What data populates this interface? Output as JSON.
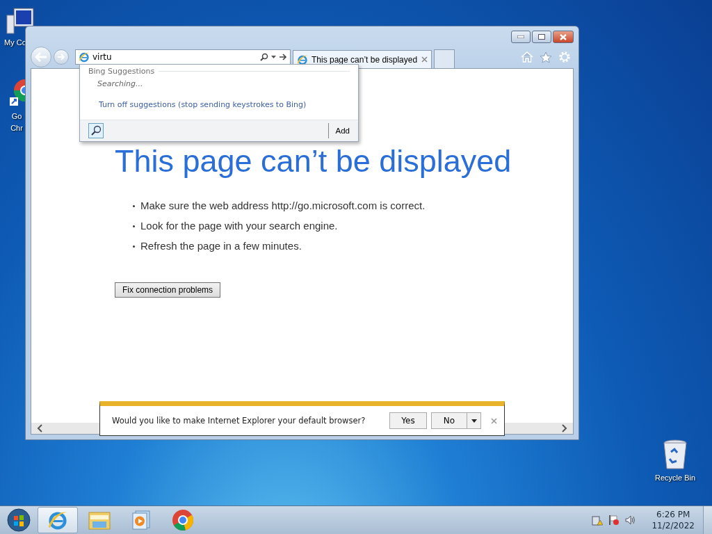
{
  "desktop_icons": [
    {
      "kind": "computer",
      "lines": [
        "My Co"
      ]
    },
    {
      "kind": "chrome-shortcut",
      "lines": [
        "Go",
        "Chr"
      ]
    },
    {
      "kind": "recycle-bin",
      "lines": [
        "Recycle Bin"
      ]
    }
  ],
  "browser": {
    "address": {
      "value": "virtu"
    },
    "tabs": [
      {
        "title": "This page can’t be displayed",
        "selected": true
      }
    ],
    "suggestions": {
      "heading": "Bing Suggestions",
      "status": "Searching...",
      "link": "Turn off suggestions (stop sending keystrokes to Bing)",
      "add": "Add"
    },
    "page": {
      "heading": "This page can’t be displayed",
      "bullets": [
        "Make sure the web address http://go.microsoft.com is correct.",
        "Look for the page with your search engine.",
        "Refresh the page in a few minutes."
      ],
      "button": "Fix connection problems"
    },
    "notification": {
      "message": "Would you like to make Internet Explorer your default browser?",
      "yes": "Yes",
      "no": "No"
    }
  },
  "taskbar": {
    "items": [
      {
        "kind": "ie",
        "active": true
      },
      {
        "kind": "explorer",
        "active": false
      },
      {
        "kind": "media",
        "active": false
      },
      {
        "kind": "chrome",
        "active": false
      }
    ],
    "clock": {
      "time": "6:26 PM",
      "date": "11/2/2022"
    }
  }
}
